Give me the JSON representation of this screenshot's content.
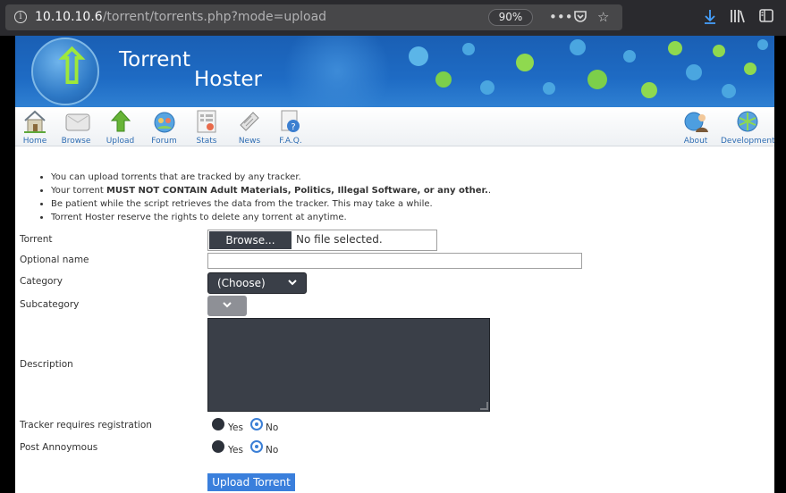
{
  "browser": {
    "url_host": "10.10.10.6",
    "url_path": "/torrent/torrents.php?mode=upload",
    "zoom": "90%",
    "icons": [
      "info-icon",
      "more-icon",
      "pocket-icon",
      "star-icon",
      "download-icon",
      "library-icon",
      "sidebar-icon"
    ]
  },
  "site": {
    "brand_line1": "Torrent",
    "brand_line2": "Hoster"
  },
  "nav": {
    "items": [
      {
        "label": "Home",
        "icon": "home-icon"
      },
      {
        "label": "Browse",
        "icon": "browse-icon"
      },
      {
        "label": "Upload",
        "icon": "upload-icon"
      },
      {
        "label": "Forum",
        "icon": "forum-icon"
      },
      {
        "label": "Stats",
        "icon": "stats-icon"
      },
      {
        "label": "News",
        "icon": "news-icon"
      },
      {
        "label": "F.A.Q.",
        "icon": "faq-icon"
      },
      {
        "label": "About",
        "icon": "about-icon"
      },
      {
        "label": "Development",
        "icon": "development-icon"
      }
    ]
  },
  "notice": {
    "b1": "You can upload torrents that are tracked by any tracker.",
    "b2_pre": "Your torrent ",
    "b2_bold": "MUST NOT CONTAIN Adult Materials, Politics, Illegal Software, or any other.",
    "b2_post": ".",
    "b3": "Be patient while the script retrieves the data from the tracker. This may take a while.",
    "b4": "Torrent Hoster reserve the rights to delete any torrent at anytime."
  },
  "form": {
    "torrent_label": "Torrent",
    "browse_label": "Browse...",
    "file_status": "No file selected.",
    "optional_name_label": "Optional name",
    "optional_name_value": "",
    "category_label": "Category",
    "category_value": "(Choose)",
    "subcategory_label": "Subcategory",
    "description_label": "Description",
    "tracker_label": "Tracker requires registration",
    "anon_label": "Post Annoymous",
    "yes": "Yes",
    "no": "No",
    "tracker_selected": "No",
    "anon_selected": "No",
    "submit_label": "Upload Torrent"
  }
}
